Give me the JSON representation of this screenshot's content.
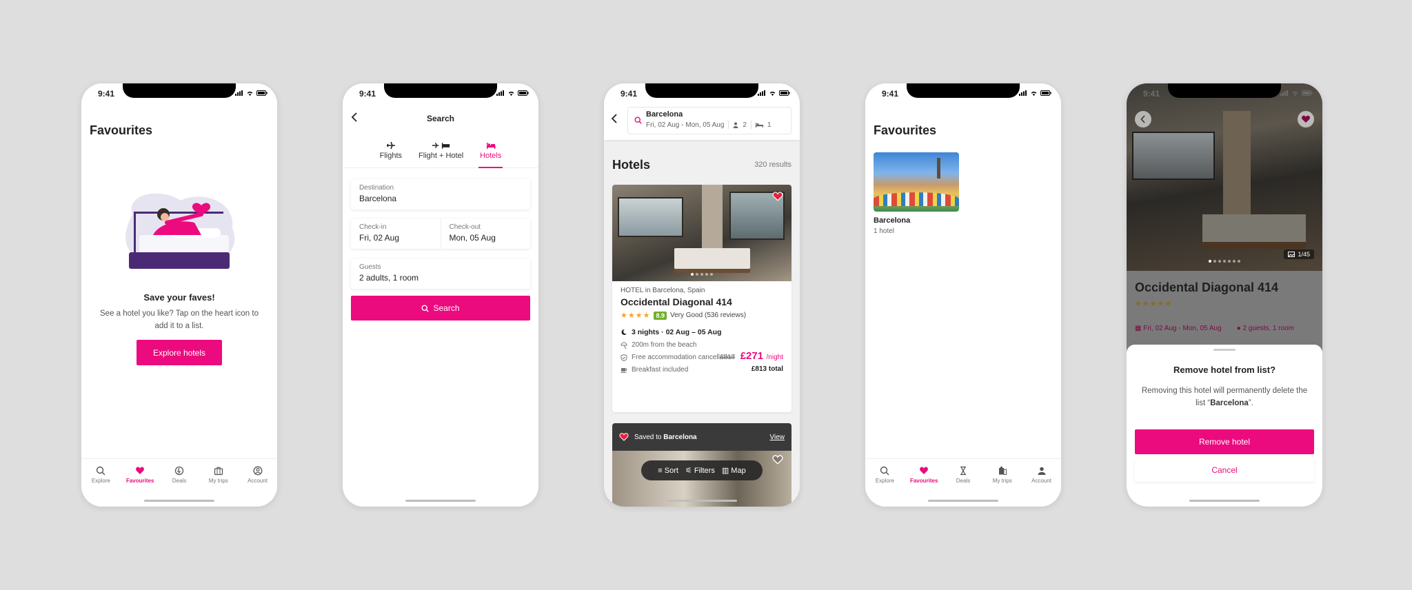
{
  "status": {
    "time": "9:41"
  },
  "colors": {
    "brand_pink": "#ec0a7f",
    "rating_green": "#6fb02c",
    "star": "#f5a623",
    "background": "#dedede"
  },
  "nav": {
    "items": [
      {
        "label": "Explore",
        "icon": "search-icon"
      },
      {
        "label": "Favourites",
        "icon": "heart-icon"
      },
      {
        "label": "Deals",
        "icon": "deals-icon"
      },
      {
        "label": "My trips",
        "icon": "suitcase-icon"
      },
      {
        "label": "Account",
        "icon": "account-icon"
      }
    ]
  },
  "screen1": {
    "title": "Favourites",
    "empty_heading": "Save your faves!",
    "empty_desc": "See a hotel you like? Tap on the heart icon to add it to a list.",
    "cta": "Explore hotels"
  },
  "screen2": {
    "title": "Search",
    "tabs": [
      {
        "label": "Flights",
        "icon": "plane-icon"
      },
      {
        "label": "Flight + Hotel",
        "icon": "plane-bed-icon"
      },
      {
        "label": "Hotels",
        "icon": "bed-icon"
      }
    ],
    "destination": {
      "label": "Destination",
      "value": "Barcelona"
    },
    "checkin": {
      "label": "Check-in",
      "value": "Fri, 02 Aug"
    },
    "checkout": {
      "label": "Check-out",
      "value": "Mon, 05 Aug"
    },
    "guests": {
      "label": "Guests",
      "value": "2 adults, 1 room"
    },
    "search_btn": "Search"
  },
  "screen3": {
    "destination": "Barcelona",
    "dates": "Fri, 02 Aug - Mon, 05 Aug",
    "guests_count": "2",
    "rooms_count": "1",
    "heading": "Hotels",
    "results": "320 results",
    "hotel": {
      "type": "HOTEL in Barcelona, Spain",
      "name": "Occidental Diagonal 414",
      "stars": "★★★★",
      "score": "8.9",
      "review_text": "Very Good (536 reviews)",
      "nights": "3 nights · 02 Aug – 05 Aug",
      "features": [
        "200m from the beach",
        "Free accommodation cancellation",
        "Breakfast included"
      ],
      "old_price": "£317",
      "price": "£271",
      "per": "/night",
      "total": "£813 total"
    },
    "toast": {
      "prefix": "Saved to",
      "list": "Barcelona",
      "action": "View"
    },
    "sortbar": {
      "sort": "Sort",
      "filters": "Filters",
      "map": "Map"
    }
  },
  "screen4": {
    "title": "Favourites",
    "list_name": "Barcelona",
    "list_count": "1 hotel"
  },
  "screen5": {
    "hotel_name": "Occidental Diagonal 414",
    "stars": "★★★★★",
    "photo_count": "1/45",
    "dates": "Fri, 02 Aug - Mon, 05 Aug",
    "guests": "2 guests, 1 room",
    "sheet_title": "Remove hotel from list?",
    "sheet_desc_pre": "Removing this hotel will permanently delete the list “",
    "sheet_desc_list": "Barcelona",
    "sheet_desc_post": "”.",
    "remove_btn": "Remove hotel",
    "cancel_btn": "Cancel"
  }
}
